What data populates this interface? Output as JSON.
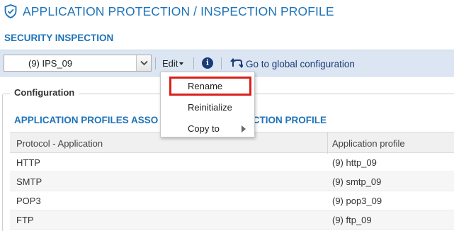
{
  "header": {
    "title": "APPLICATION PROTECTION / INSPECTION PROFILE",
    "icon": "shield-icon"
  },
  "section_title": "SECURITY INSPECTION",
  "toolbar": {
    "profile_selected": "(9) IPS_09",
    "edit_label": "Edit",
    "info_label": "i",
    "global_label": "Go to global configuration"
  },
  "edit_menu": {
    "items": [
      {
        "label": "Rename",
        "highlighted": true
      },
      {
        "label": "Reinitialize"
      },
      {
        "label": "Copy to",
        "has_submenu": true
      }
    ]
  },
  "configuration": {
    "legend": "Configuration",
    "subtitle_left": "APPLICATION PROFILES ASSO",
    "subtitle_right": "INSPECTION PROFILE",
    "columns": [
      "Protocol - Application",
      "Application profile"
    ],
    "rows": [
      {
        "protocol": "HTTP",
        "profile": "(9) http_09"
      },
      {
        "protocol": "SMTP",
        "profile": "(9) smtp_09"
      },
      {
        "protocol": "POP3",
        "profile": "(9) pop3_09"
      },
      {
        "protocol": "FTP",
        "profile": "(9) ftp_09"
      }
    ]
  },
  "colors": {
    "accent": "#1e73b8",
    "dark_blue": "#1a3b78",
    "toolbar_bg": "#dce6f2",
    "highlight_border": "#d9211c"
  }
}
